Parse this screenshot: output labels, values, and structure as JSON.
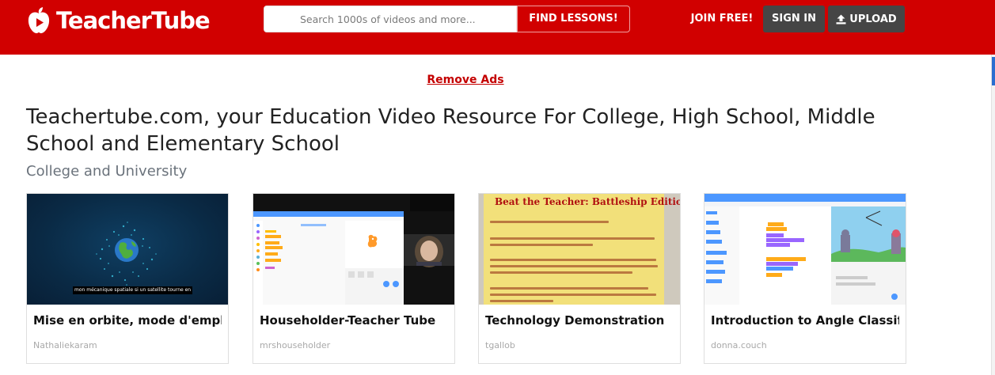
{
  "header": {
    "logo_text": "TeacherTube",
    "search_placeholder": "Search 1000s of videos and more...",
    "find_label": "FIND LESSONS!",
    "join_label": "JOIN FREE!",
    "signin_label": "SIGN IN",
    "upload_label": "UPLOAD"
  },
  "ads": {
    "remove_label": "Remove Ads"
  },
  "page": {
    "title": "Teachertube.com, your Education Video Resource For College, High School, Middle School and Elementary School",
    "section": "College and University"
  },
  "videos": [
    {
      "title": "Mise en orbite, mode d'emploi !",
      "author": "Nathaliekaram",
      "caption": "mon mécanique spatiale si un satellite tourne en"
    },
    {
      "title": "Householder-Teacher Tube",
      "author": "mrshouseholder"
    },
    {
      "title": "Technology Demonstration",
      "author": "tgallob",
      "poster_title": "Beat the Teacher: Battleship Edition"
    },
    {
      "title": "Introduction to Angle Classification",
      "author": "donna.couch"
    }
  ],
  "colors": {
    "brand_red": "#d10000",
    "dark_button": "#454545",
    "link_red": "#c40000"
  }
}
